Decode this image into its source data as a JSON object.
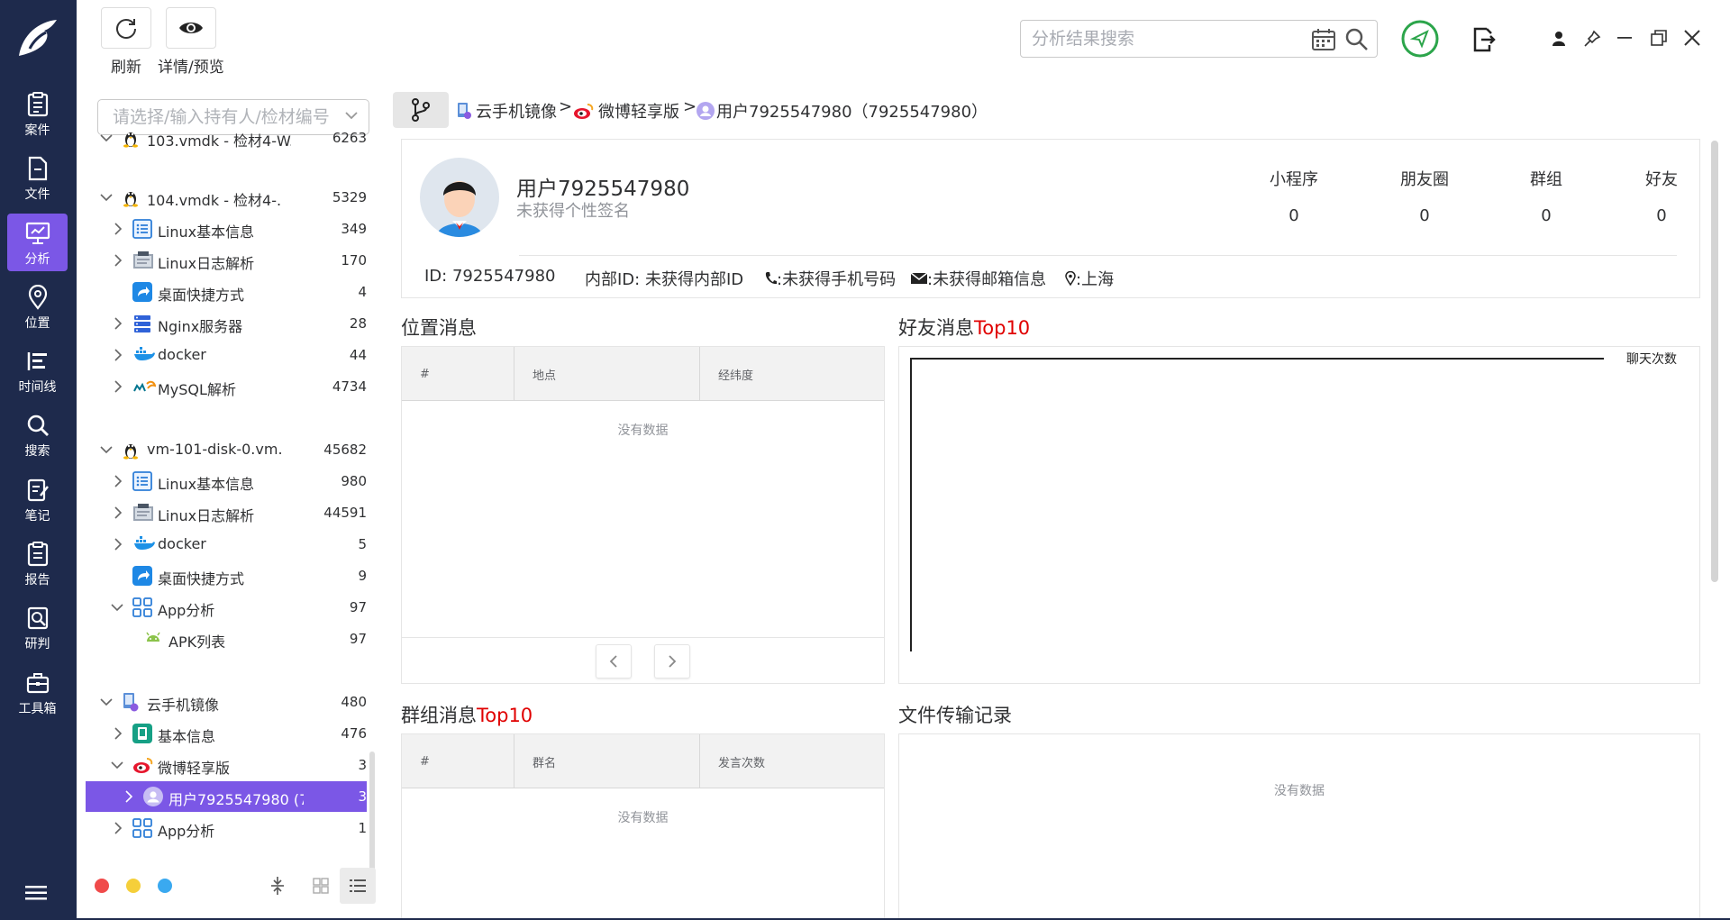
{
  "nav": {
    "items": [
      {
        "label": "案件",
        "icon": "case-icon"
      },
      {
        "label": "文件",
        "icon": "folder-icon"
      },
      {
        "label": "分析",
        "icon": "analysis-icon",
        "active": true
      },
      {
        "label": "位置",
        "icon": "location-icon"
      },
      {
        "label": "时间线",
        "icon": "timeline-icon"
      },
      {
        "label": "搜索",
        "icon": "search-icon"
      },
      {
        "label": "笔记",
        "icon": "notes-icon"
      },
      {
        "label": "报告",
        "icon": "report-icon"
      },
      {
        "label": "研判",
        "icon": "judge-icon"
      },
      {
        "label": "工具箱",
        "icon": "toolbox-icon"
      }
    ],
    "accent": "#7b57e6",
    "background": "#1e2a4c"
  },
  "toolbar": {
    "refresh_label": "刷新",
    "detail_label": "详情/预览",
    "search_placeholder": "分析结果搜索"
  },
  "tree": {
    "search_placeholder": "请选择/输入持有人/检材编号",
    "groups": {
      "g1": {
        "name": "103.vmdk - 检材4-W...",
        "count": "6263"
      },
      "g2": {
        "name": "104.vmdk - 检材4-...",
        "count": "5329",
        "children": [
          {
            "name": "Linux基本信息",
            "count": "349"
          },
          {
            "name": "Linux日志解析",
            "count": "170"
          },
          {
            "name": "桌面快捷方式",
            "count": "4"
          },
          {
            "name": "Nginx服务器",
            "count": "28"
          },
          {
            "name": "docker",
            "count": "44"
          },
          {
            "name": "MySQL解析",
            "count": "4734"
          }
        ]
      },
      "g3": {
        "name": "vm-101-disk-0.vm...",
        "count": "45682",
        "children": [
          {
            "name": "Linux基本信息",
            "count": "980"
          },
          {
            "name": "Linux日志解析",
            "count": "44591"
          },
          {
            "name": "docker",
            "count": "5"
          },
          {
            "name": "桌面快捷方式",
            "count": "9"
          },
          {
            "name": "App分析",
            "count": "97"
          },
          {
            "name": "APK列表",
            "count": "97"
          }
        ]
      },
      "g4": {
        "name": "云手机镜像",
        "count": "480",
        "children": [
          {
            "name": "基本信息",
            "count": "476"
          },
          {
            "name": "微博轻享版",
            "count": "3"
          },
          {
            "name": "用户7925547980 (7...",
            "count": "3"
          },
          {
            "name": "App分析",
            "count": "1"
          }
        ]
      }
    }
  },
  "breadcrumb": {
    "items": [
      "云手机镜像",
      "微博轻享版",
      "用户7925547980（7925547980）"
    ],
    "separator": ">"
  },
  "profile": {
    "name": "用户7925547980",
    "signature": "未获得个性签名",
    "stats": [
      {
        "label": "小程序",
        "value": "0"
      },
      {
        "label": "朋友圈",
        "value": "0"
      },
      {
        "label": "群组",
        "value": "0"
      },
      {
        "label": "好友",
        "value": "0"
      }
    ],
    "id": "ID: 7925547980",
    "internal_id": "内部ID: 未获得内部ID",
    "phone": ":未获得手机号码",
    "email": ":未获得邮箱信息",
    "location": ":上海"
  },
  "location_panel": {
    "title": "位置消息",
    "columns": [
      "#",
      "地点",
      "经纬度"
    ],
    "empty": "没有数据"
  },
  "friends_panel": {
    "title": "好友消息",
    "title_hl": "Top10",
    "legend": "聊天次数"
  },
  "groups_panel": {
    "title": "群组消息",
    "title_hl": "Top10",
    "columns": [
      "#",
      "群名",
      "发言次数"
    ],
    "empty": "没有数据"
  },
  "files_panel": {
    "title": "文件传输记录",
    "empty": "没有数据"
  },
  "chart_data": {
    "type": "bar",
    "categories": [],
    "series": [
      {
        "name": "聊天次数",
        "values": []
      }
    ],
    "title": "好友消息Top10"
  }
}
